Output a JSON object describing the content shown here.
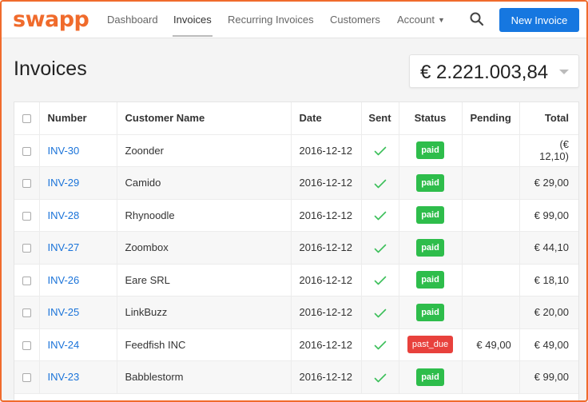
{
  "app": {
    "logo": "swapp"
  },
  "nav": {
    "items": [
      {
        "label": "Dashboard",
        "active": false
      },
      {
        "label": "Invoices",
        "active": true
      },
      {
        "label": "Recurring Invoices",
        "active": false
      },
      {
        "label": "Customers",
        "active": false
      }
    ],
    "account_label": "Account",
    "search_icon": "search-icon",
    "new_invoice_label": "New Invoice"
  },
  "page": {
    "title": "Invoices",
    "total_amount": "€ 2.221.003,84"
  },
  "colors": {
    "brand": "#f06b2c",
    "primary": "#1677e0",
    "link": "#1a73d9",
    "paid": "#2ebd4b",
    "past_due": "#e8413c",
    "check": "#3cbf5a"
  },
  "table": {
    "columns": [
      "",
      "Number",
      "Customer Name",
      "Date",
      "Sent",
      "Status",
      "Pending",
      "Total"
    ],
    "rows": [
      {
        "number": "INV-30",
        "customer": "Zoonder",
        "date": "2016-12-12",
        "sent": true,
        "status": "paid",
        "pending": "",
        "total": "(€ 12,10)"
      },
      {
        "number": "INV-29",
        "customer": "Camido",
        "date": "2016-12-12",
        "sent": true,
        "status": "paid",
        "pending": "",
        "total": "€ 29,00"
      },
      {
        "number": "INV-28",
        "customer": "Rhynoodle",
        "date": "2016-12-12",
        "sent": true,
        "status": "paid",
        "pending": "",
        "total": "€ 99,00"
      },
      {
        "number": "INV-27",
        "customer": "Zoombox",
        "date": "2016-12-12",
        "sent": true,
        "status": "paid",
        "pending": "",
        "total": "€ 44,10"
      },
      {
        "number": "INV-26",
        "customer": "Eare SRL",
        "date": "2016-12-12",
        "sent": true,
        "status": "paid",
        "pending": "",
        "total": "€ 18,10"
      },
      {
        "number": "INV-25",
        "customer": "LinkBuzz",
        "date": "2016-12-12",
        "sent": true,
        "status": "paid",
        "pending": "",
        "total": "€ 20,00"
      },
      {
        "number": "INV-24",
        "customer": "Feedfish INC",
        "date": "2016-12-12",
        "sent": true,
        "status": "past_due",
        "pending": "€ 49,00",
        "total": "€ 49,00"
      },
      {
        "number": "INV-23",
        "customer": "Babblestorm",
        "date": "2016-12-12",
        "sent": true,
        "status": "paid",
        "pending": "",
        "total": "€ 99,00"
      }
    ]
  }
}
